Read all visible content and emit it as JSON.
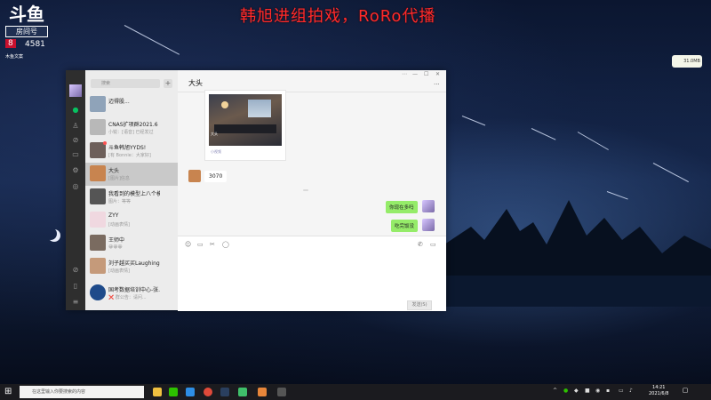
{
  "overlay": {
    "stream_title": "韩旭进组拍戏，RoRo代播",
    "logo_text": "斗鱼",
    "room_tag": "房间号",
    "room_badge": "8",
    "room_digits": "4581",
    "streamer_sub": "木鱼文案"
  },
  "tray_badge": {
    "text": "31.0MB"
  },
  "wechat": {
    "search_placeholder": "搜索",
    "plus_label": "+",
    "sidebar_icons": [
      "chat-icon",
      "contacts-icon",
      "favorites-icon",
      "files-icon",
      "moments-icon",
      "miniprogram-icon",
      "phone-icon",
      "settings-icon"
    ],
    "chats": [
      {
        "name": "迈得股...",
        "message": "",
        "time": "",
        "avatar_color": "#8fa3b9"
      },
      {
        "name": "CNAS扩项群2021.6",
        "message": "小锐：[语音] 已经发过",
        "time": "",
        "avatar_color": "#b8b8b8"
      },
      {
        "name": "斗鱼韩旭YYDS!",
        "message": "[有 Bonnie：大家好]",
        "time": "",
        "avatar_color": "#6d5f5a",
        "badge": true
      },
      {
        "name": "大头",
        "message": "[图片]信息",
        "time": "",
        "avatar_color": "#c8844f",
        "selected": true
      },
      {
        "name": "我看到的模型上八个模",
        "message": "图片：等等",
        "time": "",
        "avatar_color": "#555555"
      },
      {
        "name": "ZYY",
        "message": "[动画表情]",
        "time": "",
        "avatar_color": "#f0d8e0"
      },
      {
        "name": "王师中",
        "message": "😀😀😀",
        "time": "",
        "avatar_color": "#7a6b60"
      },
      {
        "name": "刘子越买买Laughing",
        "message": "[动画表情]",
        "time": "",
        "avatar_color": "#c59a7a"
      },
      {
        "name": "国考数据培训中心-张...",
        "message": "❌ 群公告：请问...",
        "time": "",
        "avatar_color": "#1e4a8a"
      }
    ],
    "chat_title": "大头",
    "window_controls": [
      "⋯",
      "—",
      "☐",
      "✕"
    ],
    "more_label": "···",
    "share_card": {
      "caption": "大头",
      "caption2": "",
      "footer": "小视频"
    },
    "incoming_message": "3070",
    "timestamp": "",
    "outgoing_messages": [
      "你现在多吗",
      "吃完饭没"
    ],
    "toolbar_icons": [
      "emoji-icon",
      "folder-icon",
      "scissors-icon",
      "chat-bubble-icon",
      "phone-icon",
      "video-icon"
    ],
    "send_label": "发送(S)"
  },
  "taskbar": {
    "search_placeholder": "在这里输入你要搜索的内容",
    "time": "14:21",
    "date": "2021/6/8"
  }
}
